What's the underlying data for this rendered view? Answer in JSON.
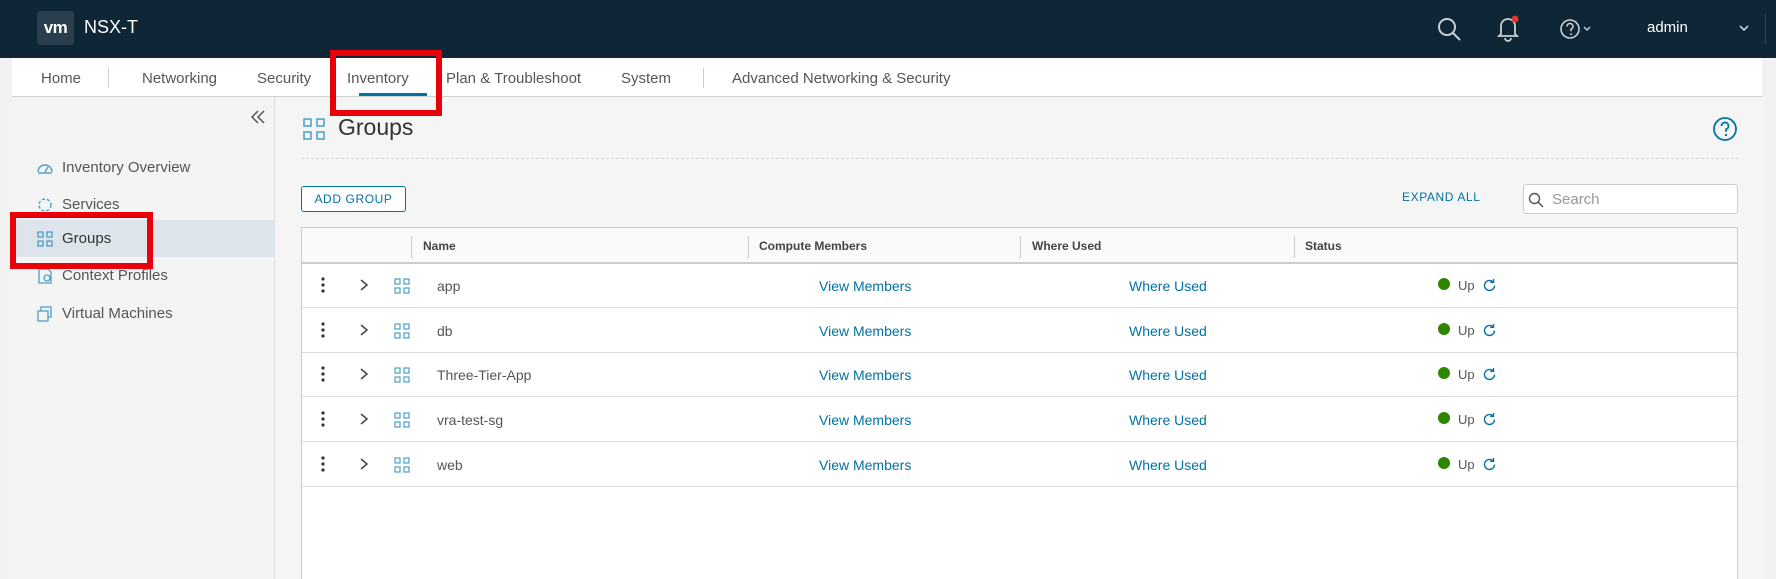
{
  "header": {
    "logo": "vm",
    "title": "NSX-T",
    "user": "admin"
  },
  "nav": {
    "tabs": [
      {
        "label": "Home"
      },
      {
        "label": "Networking"
      },
      {
        "label": "Security"
      },
      {
        "label": "Inventory",
        "active": true
      },
      {
        "label": "Plan & Troubleshoot"
      },
      {
        "label": "System"
      },
      {
        "label": "Advanced Networking & Security"
      }
    ]
  },
  "sidebar": {
    "items": [
      {
        "label": "Inventory Overview",
        "icon": "dashboard-icon"
      },
      {
        "label": "Services",
        "icon": "services-icon"
      },
      {
        "label": "Groups",
        "icon": "groups-icon",
        "active": true
      },
      {
        "label": "Context Profiles",
        "icon": "context-profiles-icon"
      },
      {
        "label": "Virtual Machines",
        "icon": "vm-icon"
      }
    ]
  },
  "main": {
    "title": "Groups",
    "add_button": "ADD GROUP",
    "expand_all": "EXPAND ALL",
    "search_placeholder": "Search"
  },
  "table": {
    "columns": [
      "Name",
      "Compute Members",
      "Where Used",
      "Status"
    ],
    "rows": [
      {
        "name": "app",
        "members": "View Members",
        "where_used": "Where Used",
        "status": "Up"
      },
      {
        "name": "db",
        "members": "View Members",
        "where_used": "Where Used",
        "status": "Up"
      },
      {
        "name": "Three-Tier-App",
        "members": "View Members",
        "where_used": "Where Used",
        "status": "Up"
      },
      {
        "name": "vra-test-sg",
        "members": "View Members",
        "where_used": "Where Used",
        "status": "Up"
      },
      {
        "name": "web",
        "members": "View Members",
        "where_used": "Where Used",
        "status": "Up"
      }
    ]
  },
  "colors": {
    "header_bg": "#0f2637",
    "accent": "#0072a3",
    "status_up": "#2e8500",
    "highlight": "#e8000b"
  }
}
